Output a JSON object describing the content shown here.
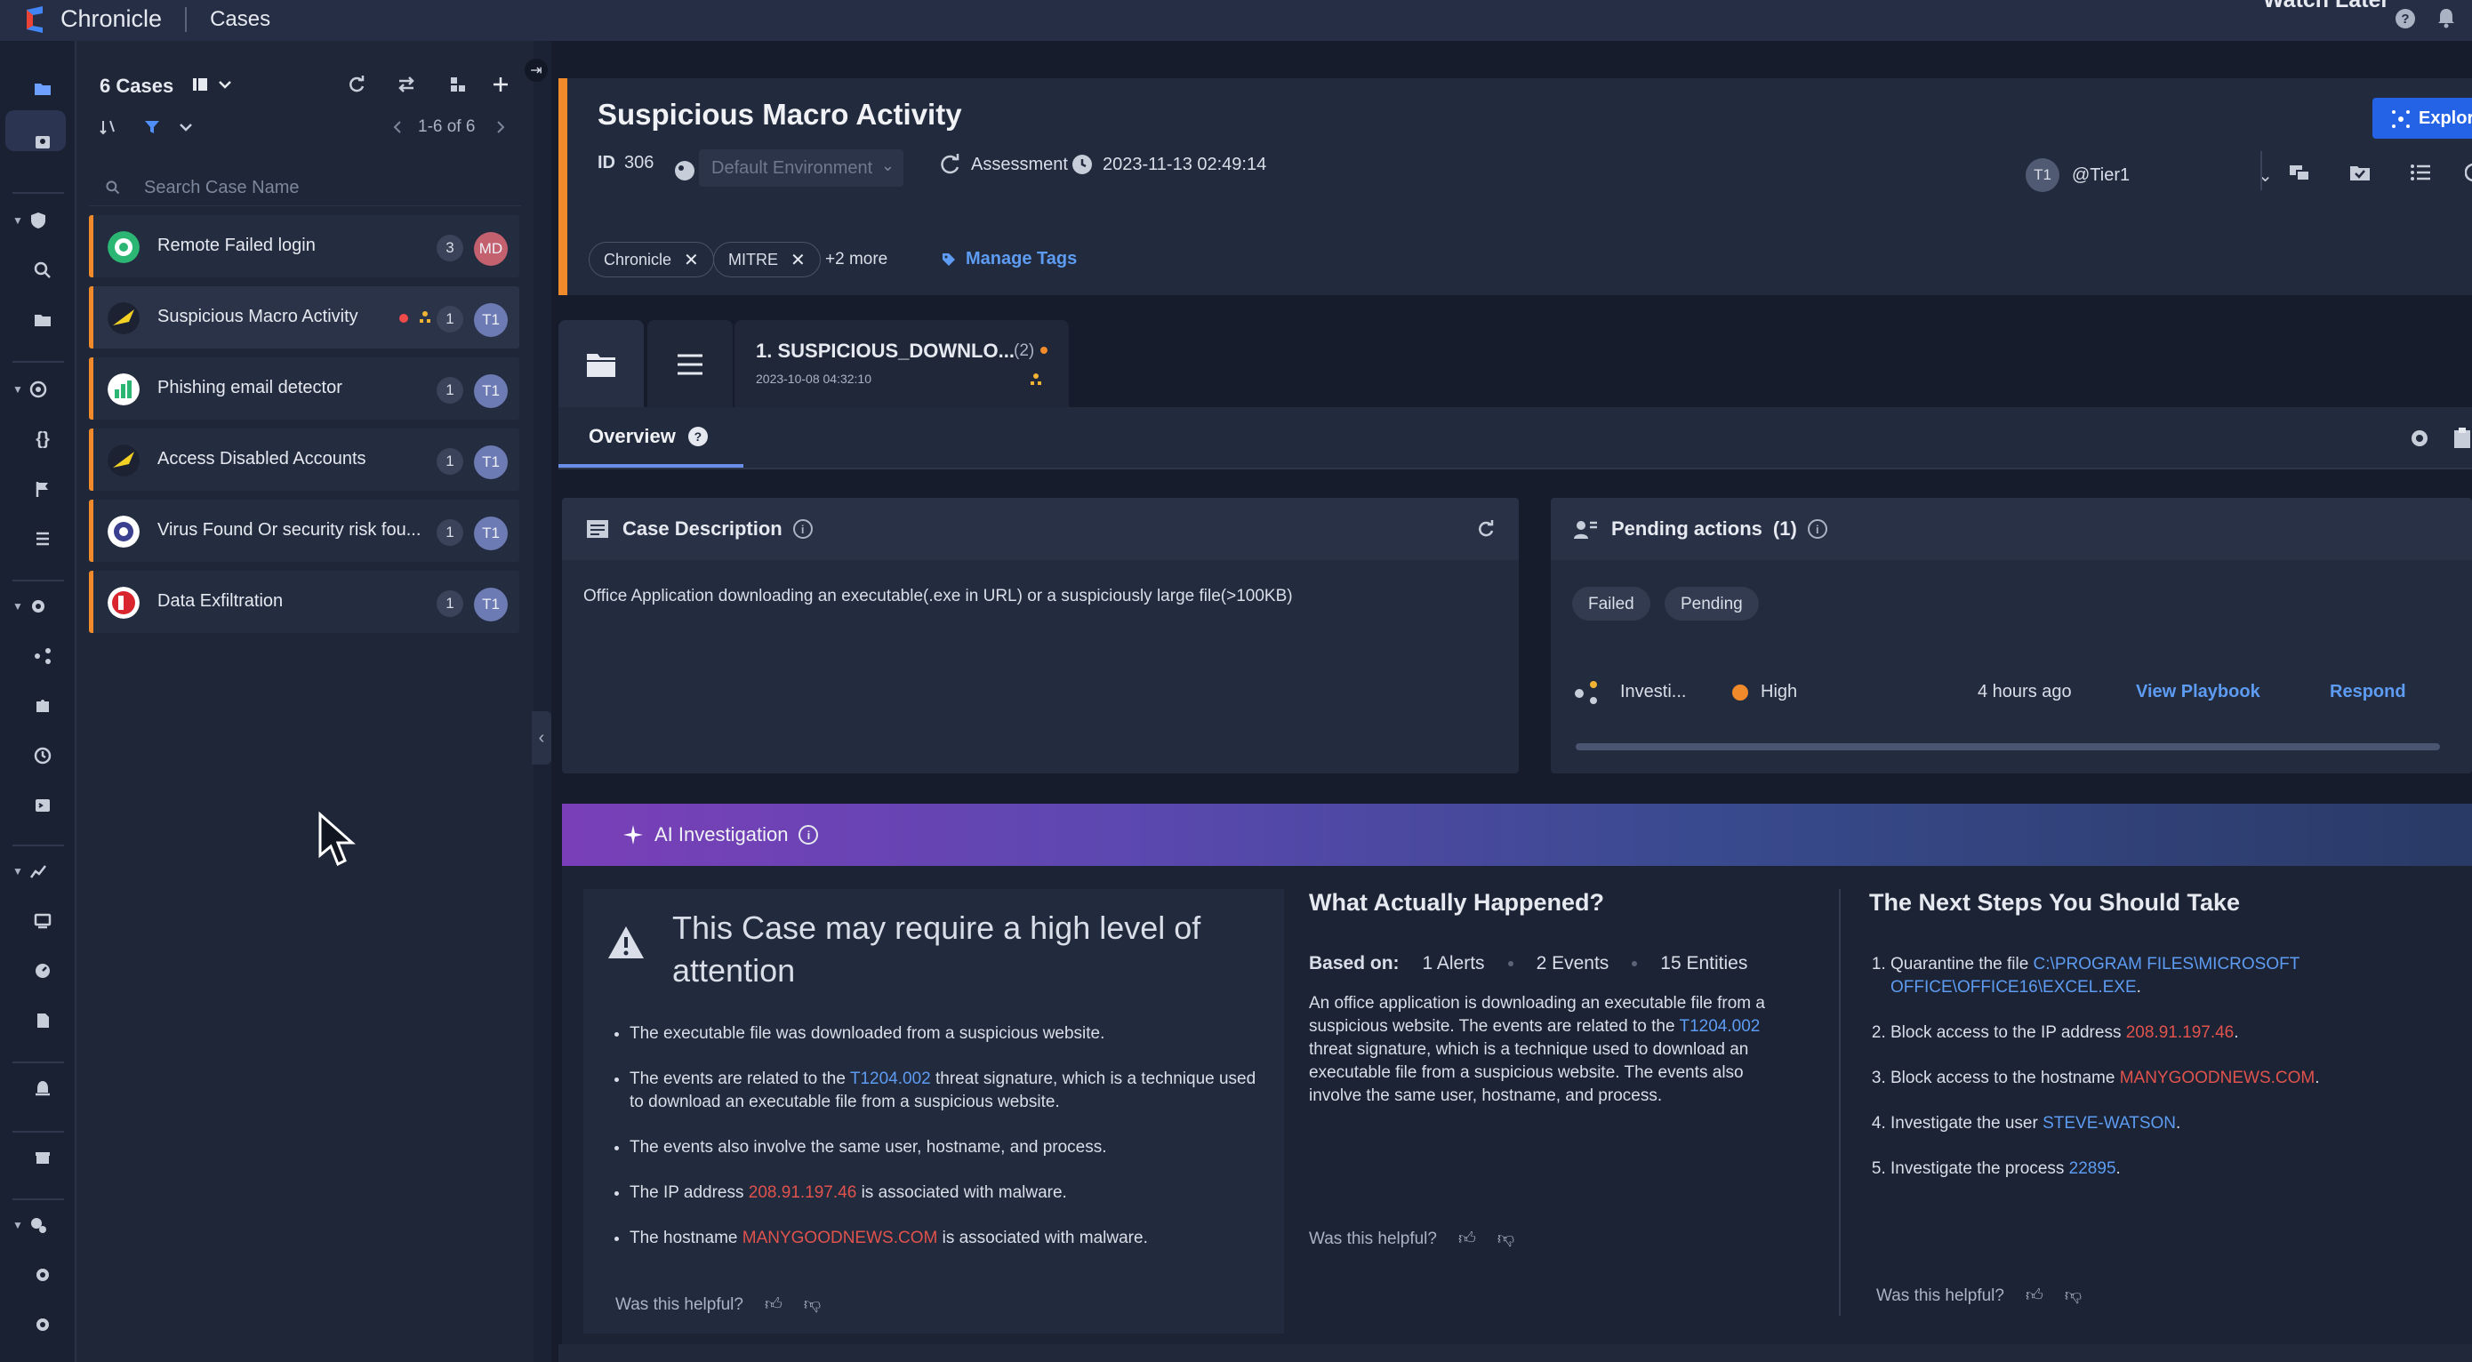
{
  "topbar": {
    "brand": "Chronicle",
    "section": "Cases",
    "user": "Watch Later"
  },
  "case_list": {
    "title": "6 Cases",
    "paging": "1-6 of 6",
    "search_placeholder": "Search Case Name",
    "items": [
      {
        "title": "Remote Failed login",
        "count": "3",
        "assignee": "MD"
      },
      {
        "title": "Suspicious Macro Activity",
        "count": "1",
        "assignee": "T1"
      },
      {
        "title": "Phishing email detector",
        "count": "1",
        "assignee": "T1"
      },
      {
        "title": "Access Disabled Accounts",
        "count": "1",
        "assignee": "T1"
      },
      {
        "title": "Virus Found Or security risk fou...",
        "count": "1",
        "assignee": "T1"
      },
      {
        "title": "Data Exfiltration",
        "count": "1",
        "assignee": "T1"
      }
    ]
  },
  "case": {
    "title": "Suspicious Macro Activity",
    "id_label": "ID",
    "id": "306",
    "environment_placeholder": "Default Environment",
    "stage": "Assessment",
    "timestamp": "2023-11-13 02:49:14",
    "assignee_avatar": "T1",
    "assignee": "@Tier1",
    "explore_label": "Explore",
    "tags": [
      "Chronicle",
      "MITRE"
    ],
    "more_tags": "+2 more",
    "manage_tags": "Manage Tags"
  },
  "alert_tab": {
    "title": "1. SUSPICIOUS_DOWNLO...",
    "count": "(2)",
    "date": "2023-10-08 04:32:10"
  },
  "overview": {
    "tab_label": "Overview"
  },
  "case_description": {
    "title": "Case Description",
    "text": "Office Application downloading an executable(.exe in URL) or a suspiciously large file(>100KB)"
  },
  "pending_actions": {
    "title": "Pending actions",
    "count": "(1)",
    "filters": [
      "Failed",
      "Pending"
    ],
    "row": {
      "name": "Investi...",
      "priority": "High",
      "time": "4 hours ago",
      "view_playbook": "View Playbook",
      "respond": "Respond"
    }
  },
  "ai": {
    "title": "AI Investigation",
    "headline": "This Case may require a high level of attention",
    "bullets": {
      "b1": "The executable file was downloaded from a suspicious website.",
      "b2_pre": "The events are related to the ",
      "b2_link": "T1204.002",
      "b2_post": " threat signature, which is a technique used to download an executable file from a suspicious website.",
      "b3": "The events also involve the same user, hostname, and process.",
      "b4_pre": "The IP address ",
      "b4_red": "208.91.197.46",
      "b4_post": " is associated with malware.",
      "b5_pre": "The hostname ",
      "b5_red": "MANYGOODNEWS.COM",
      "b5_post": " is associated with malware."
    },
    "helpful": "Was this helpful?",
    "what_happened": {
      "title": "What Actually Happened?",
      "based_on": "Based on:",
      "alerts": "1 Alerts",
      "events": "2 Events",
      "entities": "15 Entities",
      "para_pre": "An office application is downloading an executable file from a suspicious website. The events are related to the ",
      "para_link": "T1204.002",
      "para_post": " threat signature, which is a technique used to download an executable file from a suspicious website. The events also involve the same user, hostname, and process."
    },
    "next_steps": {
      "title": "The Next Steps You Should Take",
      "s1_pre": "Quarantine the file ",
      "s1_link": "C:\\PROGRAM FILES\\MICROSOFT OFFICE\\OFFICE16\\EXCEL.EXE",
      "s1_post": ".",
      "s2_pre": "Block access to the IP address ",
      "s2_red": "208.91.197.46",
      "s2_post": ".",
      "s3_pre": "Block access to the hostname ",
      "s3_red": "MANYGOODNEWS.COM",
      "s3_post": ".",
      "s4_pre": "Investigate the user ",
      "s4_link": "STEVE-WATSON",
      "s4_post": ".",
      "s5_pre": "Investigate the process ",
      "s5_link": "22895",
      "s5_post": "."
    }
  },
  "colors": {
    "accent": "#f08a2b",
    "link": "#5d9cf2",
    "danger": "#e0534d",
    "primary_button": "#2463e6"
  }
}
